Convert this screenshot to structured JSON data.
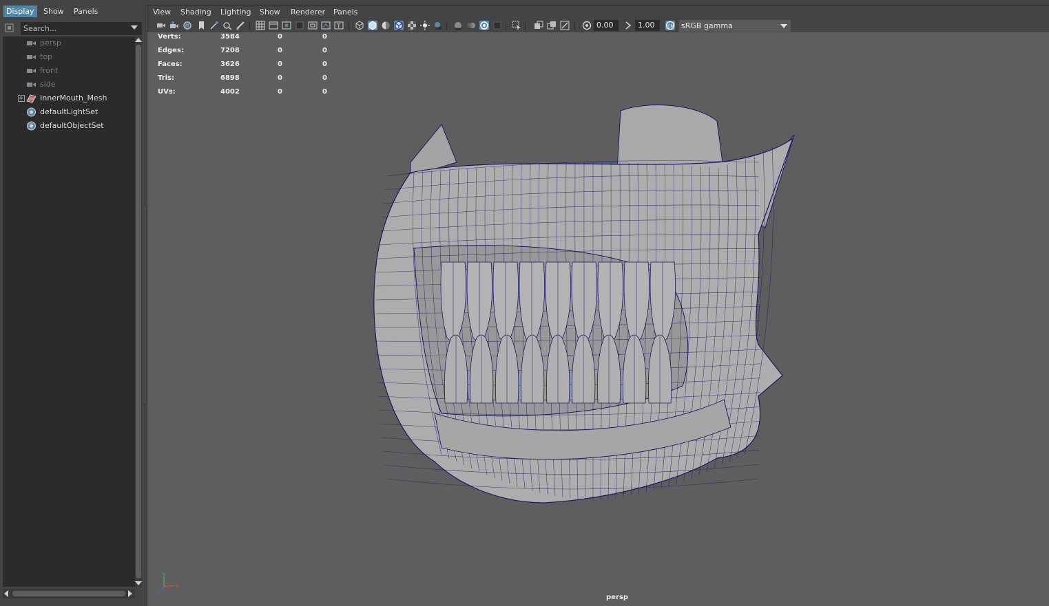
{
  "outliner": {
    "menu": [
      "Display",
      "Show",
      "Panels"
    ],
    "search_placeholder": "Search...",
    "items": [
      {
        "label": "persp",
        "icon": "camera-icon"
      },
      {
        "label": "top",
        "icon": "camera-icon"
      },
      {
        "label": "front",
        "icon": "camera-icon"
      },
      {
        "label": "side",
        "icon": "camera-icon"
      },
      {
        "label": "InnerMouth_Mesh",
        "icon": "mesh-transform-icon"
      },
      {
        "label": "defaultLightSet",
        "icon": "object-set-icon"
      },
      {
        "label": "defaultObjectSet",
        "icon": "object-set-icon"
      }
    ]
  },
  "viewport": {
    "menu": [
      "View",
      "Shading",
      "Lighting",
      "Show",
      "Renderer",
      "Panels"
    ],
    "exposure": "0.00",
    "gamma": "1.00",
    "color_management": "sRGB gamma",
    "camera": "persp",
    "wire_color": "#1a1a66",
    "selected_tool_color": "#5d88a8",
    "heads_up": [
      {
        "label": "Verts:",
        "values": [
          "3584",
          "0",
          "0"
        ]
      },
      {
        "label": "Edges:",
        "values": [
          "7208",
          "0",
          "0"
        ]
      },
      {
        "label": "Faces:",
        "values": [
          "3626",
          "0",
          "0"
        ]
      },
      {
        "label": "Tris:",
        "values": [
          "6898",
          "0",
          "0"
        ]
      },
      {
        "label": "UVs:",
        "values": [
          "4002",
          "0",
          "0"
        ]
      }
    ],
    "axis_labels": {
      "y": "y",
      "x": "x",
      "z": "z"
    }
  }
}
